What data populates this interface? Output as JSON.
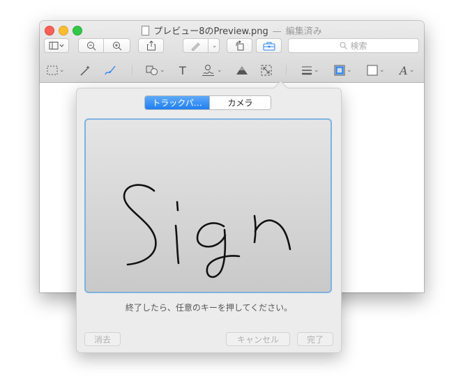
{
  "window": {
    "filename": "プレビュー8のPreview.png",
    "separator": "—",
    "status": "編集済み"
  },
  "toolbar": {
    "search_placeholder": "検索",
    "text_tool": "T"
  },
  "signature": {
    "tabs": [
      {
        "label": "トラックパ…",
        "selected": true
      },
      {
        "label": "カメラ",
        "selected": false
      }
    ],
    "instruction": "終了したら、任意のキーを押してください。",
    "clear_label": "消去",
    "cancel_label": "キャンセル",
    "done_label": "完了"
  },
  "colors": {
    "accent": "#2b86f3",
    "pad_border": "#7eb2e0",
    "close": "#fc5f57",
    "minimize": "#fdbc2e",
    "zoom": "#33c748"
  }
}
